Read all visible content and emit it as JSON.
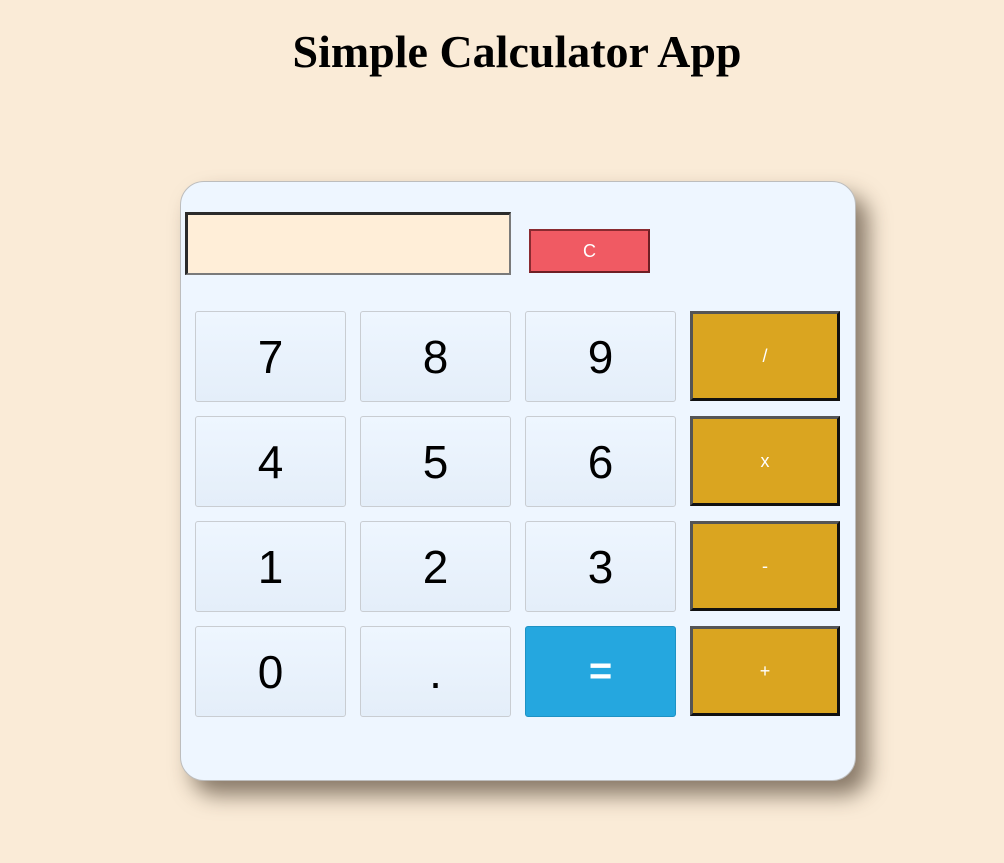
{
  "page": {
    "title": "Simple Calculator App"
  },
  "display": {
    "value": ""
  },
  "buttons": {
    "clear": "C",
    "seven": "7",
    "eight": "8",
    "nine": "9",
    "divide": "/",
    "four": "4",
    "five": "5",
    "six": "6",
    "multiply": "x",
    "one": "1",
    "two": "2",
    "three": "3",
    "subtract": "-",
    "zero": "0",
    "decimal": ".",
    "equals": "=",
    "add": "+"
  },
  "colors": {
    "page_background": "#faebd7",
    "calculator_background": "#eef6ff",
    "display_background": "#ffeed8",
    "clear_button": "#f05a63",
    "operator_button": "#daa520",
    "equals_button": "#25a7df"
  }
}
